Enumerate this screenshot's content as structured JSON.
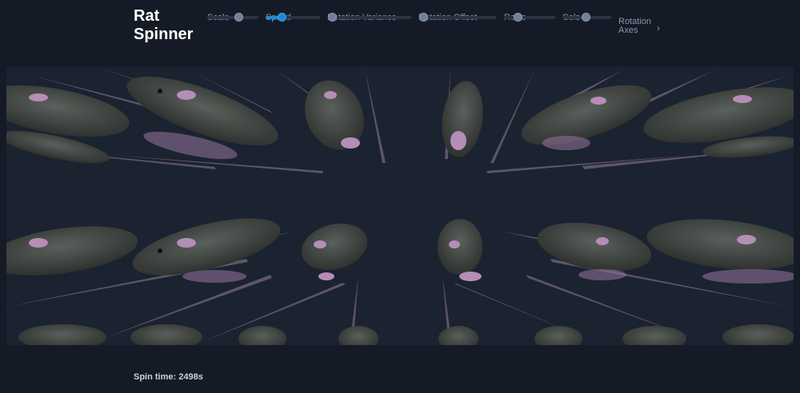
{
  "app": {
    "title": "Rat Spinner"
  },
  "controls": [
    {
      "label": "Scale",
      "value": 0.6
    },
    {
      "label": "Speed",
      "value": 0.3
    },
    {
      "label": "Rotation Variance",
      "value": 0.05
    },
    {
      "label": "Rotation Offset",
      "value": 0.05
    },
    {
      "label": "Rows",
      "value": 0.5
    },
    {
      "label": "Cols",
      "value": 0.5
    }
  ],
  "axes": {
    "label": "Rotation Axes",
    "expand_icon": "chevron-right-icon"
  },
  "status": {
    "spin_time": "Spin time: 2498s"
  },
  "colors": {
    "background": "#151b26",
    "viewport": "#1b2230",
    "accent": "#1e88d8",
    "rat_body": "#4b504c",
    "rat_pink": "#b58db7"
  }
}
